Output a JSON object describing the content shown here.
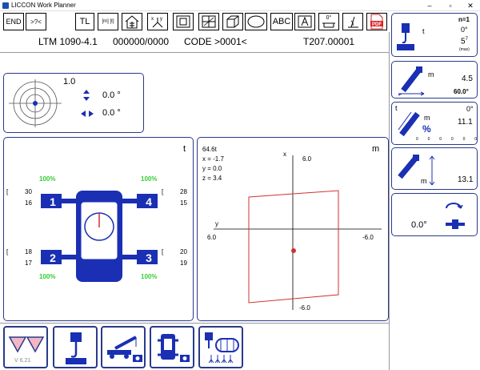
{
  "window": {
    "title": "LICCON Work Planner",
    "controls": {
      "minimize": "–",
      "maximize": "▫",
      "close": "✕"
    }
  },
  "toolbar": {
    "end_label": "END",
    "compare_label": ">?<",
    "tl_label": "TL",
    "units_label": "[m] [t]",
    "abc_label": "ABC",
    "zero_label": "0°"
  },
  "header": {
    "model": "LTM 1090-4.1",
    "number": "000000/0000",
    "code": "CODE >0001<",
    "version": "T207.00001"
  },
  "level": {
    "value": "1.0",
    "pitch": "0.0 °",
    "roll": "0.0 °"
  },
  "outrigger": {
    "unit": "t",
    "fl": {
      "top": "30",
      "bottom": "16",
      "pct": "100%",
      "num": "1"
    },
    "fr": {
      "top": "28",
      "bottom": "15",
      "pct": "100%",
      "num": "4"
    },
    "rl": {
      "top": "18",
      "bottom": "17",
      "pct": "100%",
      "num": "2"
    },
    "rr": {
      "top": "20",
      "bottom": "19",
      "pct": "100%",
      "num": "3"
    }
  },
  "cog": {
    "unit": "m",
    "load": "64.6t",
    "x": "x = -1.7",
    "y": "y = 0.0",
    "z": "z = 3.4",
    "x_axis": "x",
    "y_axis": "y",
    "x_top": "6.0",
    "x_bottom": "-6.0",
    "y_left": "6.0",
    "y_right": "-6.0"
  },
  "right": {
    "p1": {
      "n": "n=1",
      "unit": "t",
      "angle": "0°",
      "reeving": "5",
      "reeving_sup": "7",
      "max": "(max)"
    },
    "p2": {
      "unit": "m",
      "radius": "4.5",
      "angle": "60.0°"
    },
    "p3": {
      "unit_t": "t",
      "unit_m": "m",
      "pct": "%",
      "angle": "0°",
      "length": "11.1",
      "scale": [
        "0",
        "0",
        "0",
        "0",
        "0",
        "0"
      ]
    },
    "p4": {
      "unit": "m",
      "height": "13.1"
    },
    "p5": {
      "slew": "0.0°"
    }
  },
  "footer": {
    "version": "V 6.21"
  },
  "colors": {
    "accent": "#1a2fb3",
    "frame": "#2a3a8a",
    "ok": "#33cc33",
    "cog_box": "#d03030"
  }
}
